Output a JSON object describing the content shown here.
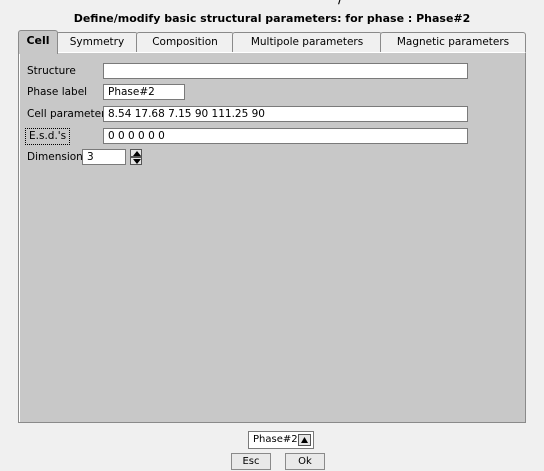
{
  "dialog": {
    "title": "Define/modify basic structural parameters: for phase : Phase#2"
  },
  "tabs": [
    {
      "label": "Cell",
      "active": true
    },
    {
      "label": "Symmetry",
      "active": false
    },
    {
      "label": "Composition",
      "active": false
    },
    {
      "label": "Multipole parameters",
      "active": false
    },
    {
      "label": "Magnetic parameters",
      "active": false
    }
  ],
  "fields": {
    "structure": {
      "label": "Structure",
      "value": ""
    },
    "phase_label": {
      "label": "Phase label",
      "value": "Phase#2"
    },
    "cell_parameters": {
      "label": "Cell parameters",
      "value": "8.54 17.68 7.15 90 111.25 90"
    },
    "esds": {
      "label": "E.s.d.'s",
      "value": "0 0 0 0 0 0"
    },
    "dimension": {
      "label": "Dimension",
      "value": "3"
    }
  },
  "footer": {
    "phase_select": "Phase#2",
    "esc_label": "Esc",
    "ok_label": "Ok"
  },
  "icons": {
    "spinner_up": "triangle-up-icon",
    "spinner_down": "triangle-down-icon",
    "phase_up": "triangle-up-icon"
  },
  "colors": {
    "panel_bg": "#c8c8c8",
    "window_bg": "#f0f0f0"
  }
}
